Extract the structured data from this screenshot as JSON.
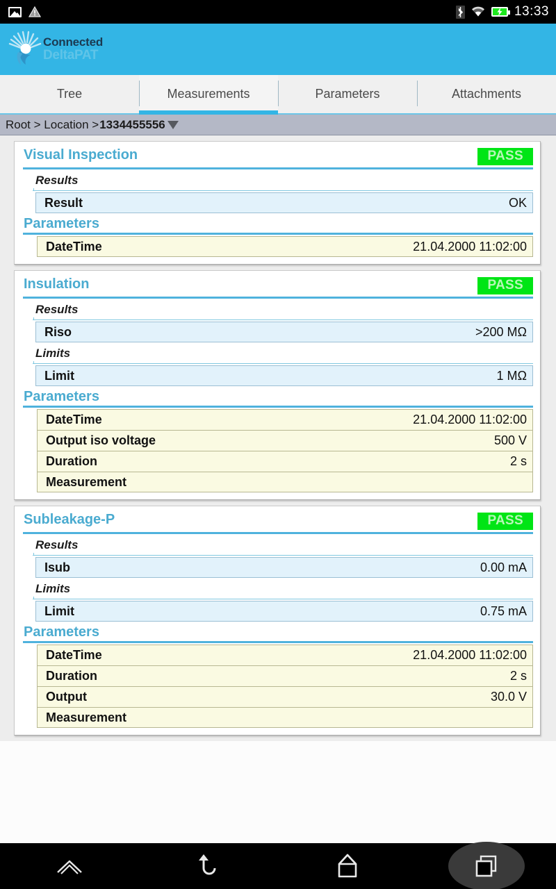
{
  "status_bar": {
    "icons_left": [
      "image-icon",
      "warning-icon"
    ],
    "icons_right": [
      "bluetooth-icon",
      "wifi-icon",
      "battery-charging-icon"
    ],
    "time": "13:33"
  },
  "app_bar": {
    "logo_icon": "sunburst-logo-icon",
    "title_top": "Connected",
    "title_bottom": "DeltaPAT"
  },
  "tabs": [
    {
      "label": "Tree",
      "active": false
    },
    {
      "label": "Measurements",
      "active": true
    },
    {
      "label": "Parameters",
      "active": false
    },
    {
      "label": "Attachments",
      "active": false
    }
  ],
  "breadcrumb": {
    "path": "Root > Location > ",
    "current": "1334455556",
    "caret_icon": "chevron-down-icon"
  },
  "cards": [
    {
      "title": "Visual Inspection",
      "status": "PASS",
      "groups": [
        {
          "label": "Results",
          "style": "result",
          "rows": [
            {
              "key": "Result",
              "value": "OK"
            }
          ]
        }
      ],
      "parameters": {
        "label": "Parameters",
        "rows": [
          {
            "key": "DateTime",
            "value": "21.04.2000 11:02:00"
          }
        ]
      }
    },
    {
      "title": "Insulation",
      "status": "PASS",
      "groups": [
        {
          "label": "Results",
          "style": "result",
          "rows": [
            {
              "key": "Riso",
              "value": ">200 MΩ"
            }
          ]
        },
        {
          "label": "Limits",
          "style": "result",
          "rows": [
            {
              "key": "Limit",
              "value": "1 MΩ"
            }
          ]
        }
      ],
      "parameters": {
        "label": "Parameters",
        "rows": [
          {
            "key": "DateTime",
            "value": "21.04.2000 11:02:00"
          },
          {
            "key": "Output iso voltage",
            "value": "500 V"
          },
          {
            "key": "Duration",
            "value": "2 s"
          },
          {
            "key": "Measurement",
            "value": ""
          }
        ]
      }
    },
    {
      "title": "Subleakage-P",
      "status": "PASS",
      "groups": [
        {
          "label": "Results",
          "style": "result",
          "rows": [
            {
              "key": "Isub",
              "value": "0.00 mA"
            }
          ]
        },
        {
          "label": "Limits",
          "style": "result",
          "rows": [
            {
              "key": "Limit",
              "value": "0.75 mA"
            }
          ]
        }
      ],
      "parameters": {
        "label": "Parameters",
        "rows": [
          {
            "key": "DateTime",
            "value": "21.04.2000 11:02:00"
          },
          {
            "key": "Duration",
            "value": "2 s"
          },
          {
            "key": "Output",
            "value": "30.0 V"
          },
          {
            "key": "Measurement",
            "value": ""
          }
        ]
      }
    }
  ],
  "nav_bar": {
    "buttons": [
      {
        "icon": "menu-caret-icon",
        "highlight": false
      },
      {
        "icon": "back-icon",
        "highlight": false
      },
      {
        "icon": "home-icon",
        "highlight": false
      },
      {
        "icon": "recent-apps-icon",
        "highlight": true
      }
    ]
  },
  "colors": {
    "accent": "#33B5E5",
    "title": "#4aabd0",
    "pass_badge_bg": "#00E515",
    "result_row_bg": "#E2F2FB",
    "param_row_bg": "#FAFAE2",
    "page_bg": "#EDEDED",
    "breadcrumb_bg": "#B4B8C6"
  }
}
